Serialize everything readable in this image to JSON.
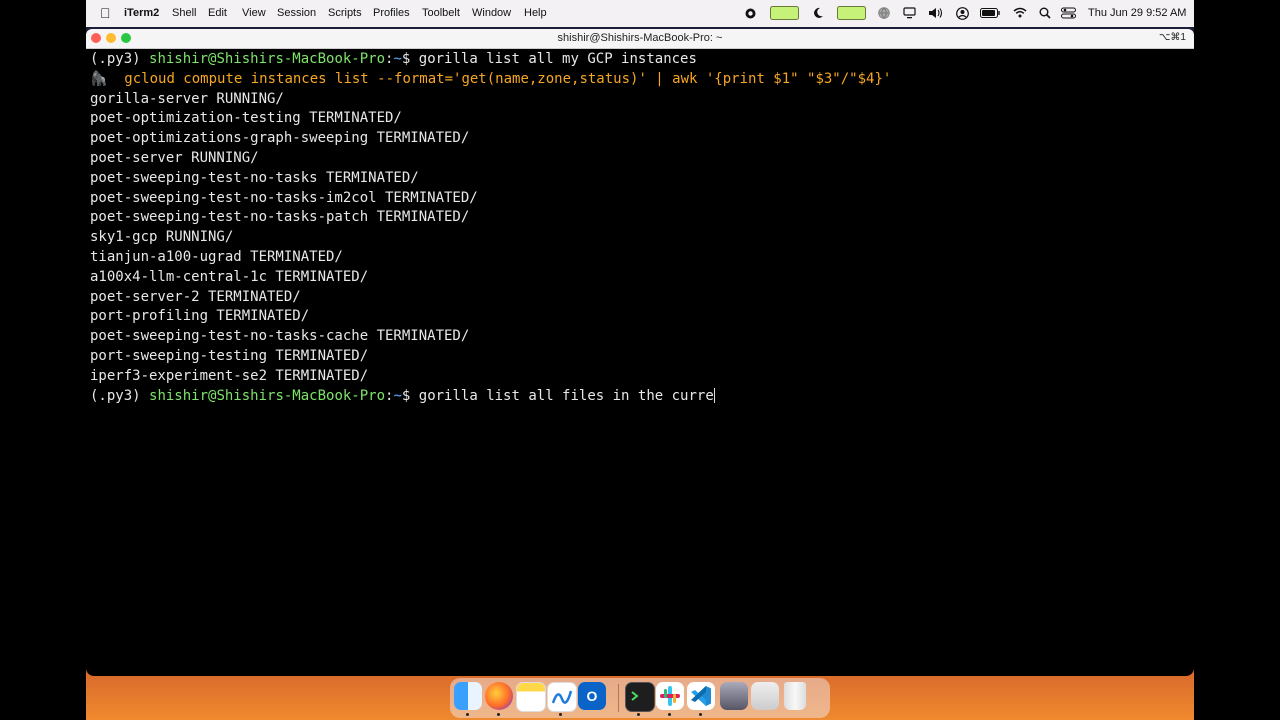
{
  "menubar": {
    "app_name": "iTerm2",
    "items": [
      "Shell",
      "Edit",
      "View",
      "Session",
      "Scripts",
      "Profiles",
      "Toolbelt",
      "Window",
      "Help"
    ],
    "clock": "Thu Jun 29  9:52 AM"
  },
  "window": {
    "title": "shishir@Shishirs-MacBook-Pro: ~",
    "shortcut": "⌥⌘1"
  },
  "terminal": {
    "prompt": {
      "env": "(.py3) ",
      "user_host": "shishir@Shishirs-MacBook-Pro",
      "colon": ":",
      "tilde": "~",
      "dollar": "$ "
    },
    "command_1": "gorilla list all my GCP instances",
    "suggestion_icon": "🦍",
    "suggested_command": "gcloud compute instances list --format='get(name,zone,status)' | awk '{print $1\" \"$3\"/\"$4}'",
    "output": [
      "gorilla-server RUNNING/",
      "poet-optimization-testing TERMINATED/",
      "poet-optimizations-graph-sweeping TERMINATED/",
      "poet-server RUNNING/",
      "poet-sweeping-test-no-tasks TERMINATED/",
      "poet-sweeping-test-no-tasks-im2col TERMINATED/",
      "poet-sweeping-test-no-tasks-patch TERMINATED/",
      "sky1-gcp RUNNING/",
      "tianjun-a100-ugrad TERMINATED/",
      "a100x4-llm-central-1c TERMINATED/",
      "poet-server-2 TERMINATED/",
      "port-profiling TERMINATED/",
      "poet-sweeping-test-no-tasks-cache TERMINATED/",
      "port-sweeping-testing TERMINATED/",
      "iperf3-experiment-se2 TERMINATED/"
    ],
    "current_input": "gorilla list all files in the curre"
  },
  "dock": {
    "apps": [
      "finder-icon",
      "firefox-icon",
      "notes-icon",
      "freeform-icon",
      "outlook-icon",
      "terminal-icon",
      "slack-icon",
      "vscode-icon",
      "screenshot-icon",
      "keyboard-icon",
      "trash-icon"
    ]
  },
  "colors": {
    "prompt_user": "#7ee36a",
    "prompt_path": "#5aa9ff",
    "suggestion": "#f5a623",
    "terminal_bg": "#000000",
    "terminal_text": "#e8e8e8"
  }
}
